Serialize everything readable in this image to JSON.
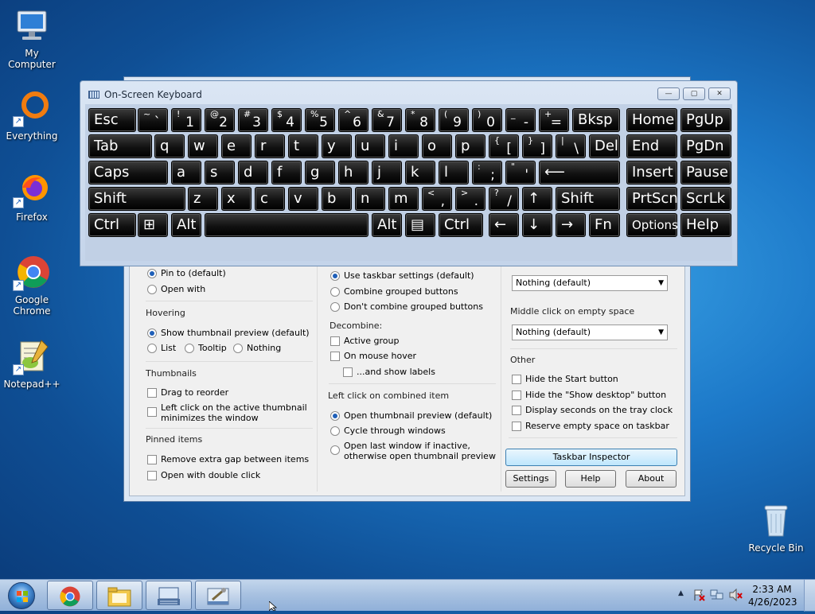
{
  "desktop": {
    "icons": [
      {
        "label": "My Computer",
        "icon": "computer-icon"
      },
      {
        "label": "Everything",
        "icon": "everything-icon"
      },
      {
        "label": "Firefox",
        "icon": "firefox-icon"
      },
      {
        "label": "Google Chrome",
        "icon": "chrome-icon"
      },
      {
        "label": "Notepad++",
        "icon": "notepadpp-icon"
      },
      {
        "label": "Recycle Bin",
        "icon": "recycle-bin-icon"
      }
    ]
  },
  "osk": {
    "title": "On-Screen Keyboard",
    "controls": {
      "minimize": "—",
      "restore": "▢",
      "close": "✕"
    },
    "rows": [
      [
        {
          "lbl": "Esc"
        },
        {
          "top": "~",
          "bot": "`"
        },
        {
          "top": "!",
          "bot": "1"
        },
        {
          "top": "@",
          "bot": "2"
        },
        {
          "top": "#",
          "bot": "3"
        },
        {
          "top": "$",
          "bot": "4"
        },
        {
          "top": "%",
          "bot": "5"
        },
        {
          "top": "^",
          "bot": "6"
        },
        {
          "top": "&",
          "bot": "7"
        },
        {
          "top": "*",
          "bot": "8"
        },
        {
          "top": "(",
          "bot": "9"
        },
        {
          "top": ")",
          "bot": "0"
        },
        {
          "top": "_",
          "bot": "-"
        },
        {
          "top": "+",
          "bot": "="
        },
        {
          "lbl": "Bksp"
        },
        {
          "lbl": "Home"
        },
        {
          "lbl": "PgUp"
        }
      ],
      [
        {
          "lbl": "Tab"
        },
        {
          "lbl": "q"
        },
        {
          "lbl": "w"
        },
        {
          "lbl": "e"
        },
        {
          "lbl": "r"
        },
        {
          "lbl": "t"
        },
        {
          "lbl": "y"
        },
        {
          "lbl": "u"
        },
        {
          "lbl": "i"
        },
        {
          "lbl": "o"
        },
        {
          "lbl": "p"
        },
        {
          "top": "{",
          "bot": "["
        },
        {
          "top": "}",
          "bot": "]"
        },
        {
          "top": "|",
          "bot": "\\"
        },
        {
          "lbl": "Del"
        },
        {
          "lbl": "End"
        },
        {
          "lbl": "PgDn"
        }
      ],
      [
        {
          "lbl": "Caps"
        },
        {
          "lbl": "a"
        },
        {
          "lbl": "s"
        },
        {
          "lbl": "d"
        },
        {
          "lbl": "f"
        },
        {
          "lbl": "g"
        },
        {
          "lbl": "h"
        },
        {
          "lbl": "j"
        },
        {
          "lbl": "k"
        },
        {
          "lbl": "l"
        },
        {
          "top": ":",
          "bot": ";"
        },
        {
          "top": "\"",
          "bot": "'"
        },
        {
          "lbl": "⟵"
        },
        {
          "lbl": "Insert"
        },
        {
          "lbl": "Pause"
        }
      ],
      [
        {
          "lbl": "Shift"
        },
        {
          "lbl": "z"
        },
        {
          "lbl": "x"
        },
        {
          "lbl": "c"
        },
        {
          "lbl": "v"
        },
        {
          "lbl": "b"
        },
        {
          "lbl": "n"
        },
        {
          "lbl": "m"
        },
        {
          "top": "<",
          "bot": ","
        },
        {
          "top": ">",
          "bot": "."
        },
        {
          "top": "?",
          "bot": "/"
        },
        {
          "lbl": "↑"
        },
        {
          "lbl": "Shift"
        },
        {
          "lbl": "PrtScn"
        },
        {
          "lbl": "ScrLk"
        }
      ],
      [
        {
          "lbl": "Ctrl"
        },
        {
          "lbl": "⊞"
        },
        {
          "lbl": "Alt"
        },
        {
          "lbl": ""
        },
        {
          "lbl": "Alt"
        },
        {
          "lbl": "▤"
        },
        {
          "lbl": "Ctrl"
        },
        {
          "lbl": "←"
        },
        {
          "lbl": "↓"
        },
        {
          "lbl": "→"
        },
        {
          "lbl": "Fn"
        },
        {
          "lbl": "Options"
        },
        {
          "lbl": "Help"
        }
      ]
    ]
  },
  "inspector": {
    "col1": {
      "pin_to": "Pin to (default)",
      "open_with": "Open with",
      "hovering_title": "Hovering",
      "show_thumb": "Show thumbnail preview (default)",
      "list": "List",
      "tooltip": "Tooltip",
      "nothing": "Nothing",
      "thumbnails_title": "Thumbnails",
      "drag_reorder": "Drag to reorder",
      "left_click_line1": "Left click on the active thumbnail",
      "left_click_line2": "minimizes the window",
      "pinned_title": "Pinned items",
      "remove_gap": "Remove extra gap between items",
      "open_double": "Open with double click"
    },
    "col2": {
      "use_taskbar": "Use taskbar settings (default)",
      "combine_grouped": "Combine grouped buttons",
      "dont_combine": "Don't combine grouped buttons",
      "decombine_title": "Decombine:",
      "active_group": "Active group",
      "on_mouse_hover": "On mouse hover",
      "and_show_labels": "...and show labels",
      "left_click_title": "Left click on combined item",
      "open_thumb": "Open thumbnail preview (default)",
      "cycle": "Cycle through windows",
      "open_last_line1": "Open last window if inactive,",
      "open_last_line2": "otherwise open thumbnail preview"
    },
    "col3": {
      "combo1_value": "Nothing (default)",
      "middle_click_title": "Middle click on empty space",
      "combo2_value": "Nothing (default)",
      "other_title": "Other",
      "hide_start": "Hide the Start button",
      "hide_show_desktop": "Hide the \"Show desktop\" button",
      "display_seconds": "Display seconds on the tray clock",
      "reserve_space": "Reserve empty space on taskbar"
    },
    "buttons": {
      "inspector": "Taskbar Inspector",
      "settings": "Settings",
      "help": "Help",
      "about": "About"
    }
  },
  "taskbar": {
    "pinned": [
      "chrome-icon",
      "explorer-icon",
      "osk-icon",
      "taskbar-tweaker-icon"
    ],
    "time": "2:33 AM",
    "date": "4/26/2023",
    "tray_chevron": "▲"
  }
}
